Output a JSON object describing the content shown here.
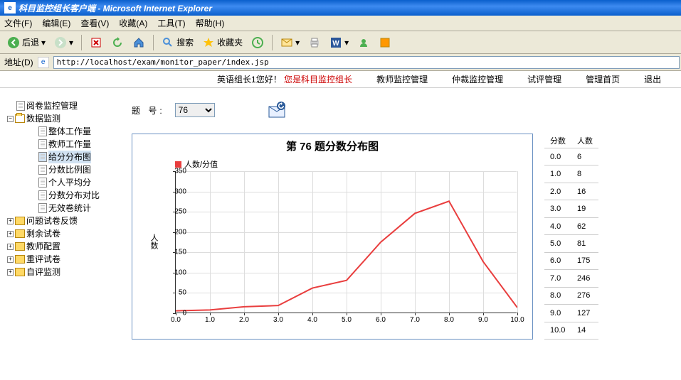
{
  "window": {
    "title": "科目监控组长客户端 - Microsoft Internet Explorer"
  },
  "menubar": [
    "文件(F)",
    "编辑(E)",
    "查看(V)",
    "收藏(A)",
    "工具(T)",
    "帮助(H)"
  ],
  "toolbar": {
    "back": "后退",
    "search": "搜索",
    "fav": "收藏夹"
  },
  "addr": {
    "label": "地址(D)",
    "url": "http://localhost/exam/monitor_paper/index.jsp"
  },
  "nav": {
    "greet_name": "英语组长1",
    "greet_suffix": "您好！",
    "greet_role": "您是科目监控组长",
    "links": [
      "教师监控管理",
      "仲裁监控管理",
      "试评管理",
      "管理首页",
      "退出"
    ]
  },
  "tree": {
    "root": "阅卷监控管理",
    "data_monitor": "数据监测",
    "leaves": [
      "整体工作量",
      "教师工作量",
      "给分分布图",
      "分数比例图",
      "个人平均分",
      "分数分布对比",
      "无效卷统计"
    ],
    "selected_index": 2,
    "others": [
      "问题试卷反馈",
      "剩余试卷",
      "教师配置",
      "重评试卷",
      "自评监测"
    ]
  },
  "question": {
    "label": "题 号:",
    "value": "76"
  },
  "table_head": [
    "分数",
    "人数"
  ],
  "chart_data": {
    "type": "line",
    "title": "第 76 题分数分布图",
    "legend": "人数/分值",
    "ylabel": "人数",
    "xlabel": "",
    "x": [
      0.0,
      1.0,
      2.0,
      3.0,
      4.0,
      5.0,
      6.0,
      7.0,
      8.0,
      9.0,
      10.0
    ],
    "values": [
      6,
      8,
      16,
      19,
      62,
      81,
      175,
      246,
      276,
      127,
      14
    ],
    "ylim": [
      0,
      350
    ],
    "yticks": [
      0,
      50,
      100,
      150,
      200,
      250,
      300,
      350
    ]
  }
}
